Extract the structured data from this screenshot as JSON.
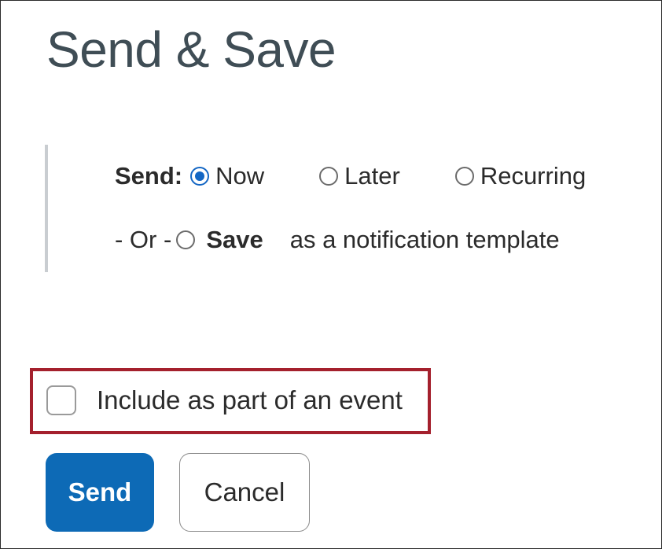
{
  "page": {
    "title": "Send & Save"
  },
  "send_options": {
    "send_label": "Send:",
    "now_label": "Now",
    "later_label": "Later",
    "recurring_label": "Recurring",
    "selected": "Now",
    "or_label": "- Or -",
    "save_label": "Save",
    "template_label": "as a notification template"
  },
  "event": {
    "checkbox_label": "Include as part of an event",
    "checked": false
  },
  "actions": {
    "send_label": "Send",
    "cancel_label": "Cancel"
  },
  "colors": {
    "accent": "#1366c4",
    "primary_button": "#0d6ab6",
    "highlight_border": "#a4202d",
    "title_text": "#3f4d55"
  }
}
